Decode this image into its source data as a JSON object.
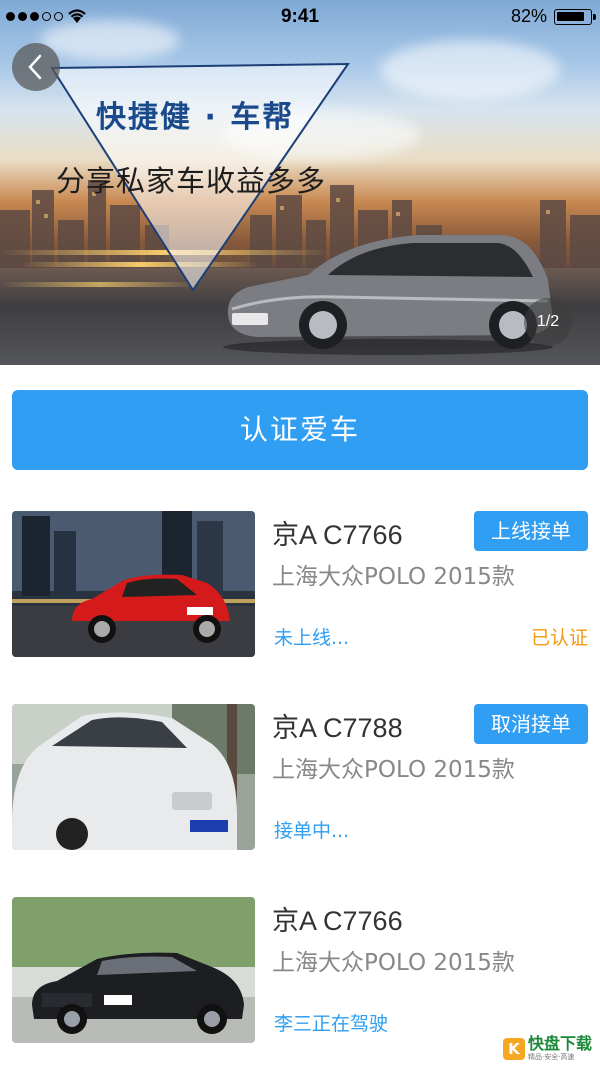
{
  "status_bar": {
    "time": "9:41",
    "battery_percent": "82%",
    "battery_level": 0.82,
    "signal_bars": 3
  },
  "banner": {
    "title": "快捷健 · 车帮",
    "subtitle": "分享私家车收益多多",
    "pager": "1/2",
    "back_icon": "chevron-left-icon"
  },
  "certify_button": {
    "label": "认证爱车"
  },
  "cars": [
    {
      "plate": "京A C7766",
      "model": "上海大众POLO 2015款",
      "status": "未上线...",
      "auth": "已认证",
      "action": "上线接单"
    },
    {
      "plate": "京A C7788",
      "model": "上海大众POLO 2015款",
      "status": "接单中...",
      "auth": "",
      "action": "取消接单"
    },
    {
      "plate": "京A C7766",
      "model": "上海大众POLO 2015款",
      "status": "李三正在驾驶",
      "auth": "",
      "action": ""
    }
  ],
  "watermark": {
    "logo": "K",
    "name": "快盘下载",
    "tagline": "精品·安全·高速"
  },
  "colors": {
    "accent": "#2f9ef3",
    "auth": "#f39a12",
    "title_blue": "#1a4a8c"
  }
}
